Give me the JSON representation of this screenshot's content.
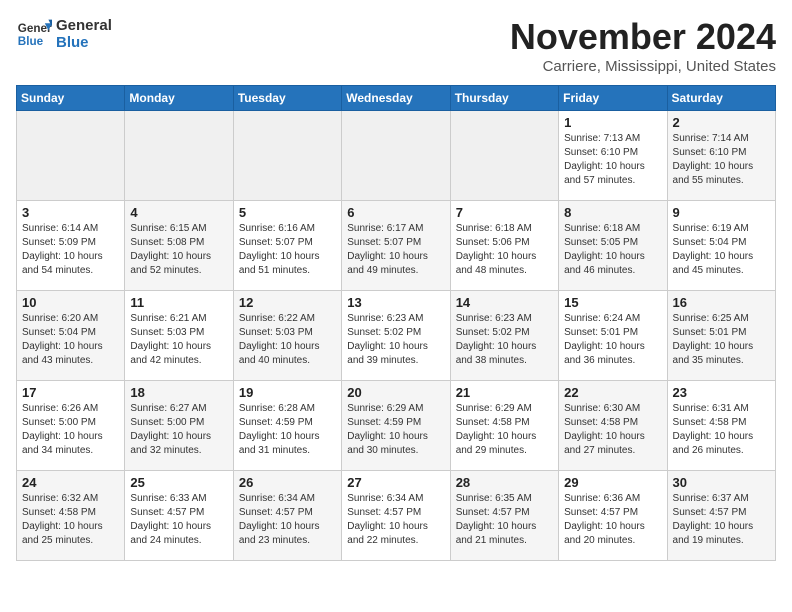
{
  "header": {
    "logo_line1": "General",
    "logo_line2": "Blue",
    "month": "November 2024",
    "location": "Carriere, Mississippi, United States"
  },
  "weekdays": [
    "Sunday",
    "Monday",
    "Tuesday",
    "Wednesday",
    "Thursday",
    "Friday",
    "Saturday"
  ],
  "weeks": [
    [
      {
        "day": "",
        "info": ""
      },
      {
        "day": "",
        "info": ""
      },
      {
        "day": "",
        "info": ""
      },
      {
        "day": "",
        "info": ""
      },
      {
        "day": "",
        "info": ""
      },
      {
        "day": "1",
        "info": "Sunrise: 7:13 AM\nSunset: 6:10 PM\nDaylight: 10 hours and 57 minutes."
      },
      {
        "day": "2",
        "info": "Sunrise: 7:14 AM\nSunset: 6:10 PM\nDaylight: 10 hours and 55 minutes."
      }
    ],
    [
      {
        "day": "3",
        "info": "Sunrise: 6:14 AM\nSunset: 5:09 PM\nDaylight: 10 hours and 54 minutes."
      },
      {
        "day": "4",
        "info": "Sunrise: 6:15 AM\nSunset: 5:08 PM\nDaylight: 10 hours and 52 minutes."
      },
      {
        "day": "5",
        "info": "Sunrise: 6:16 AM\nSunset: 5:07 PM\nDaylight: 10 hours and 51 minutes."
      },
      {
        "day": "6",
        "info": "Sunrise: 6:17 AM\nSunset: 5:07 PM\nDaylight: 10 hours and 49 minutes."
      },
      {
        "day": "7",
        "info": "Sunrise: 6:18 AM\nSunset: 5:06 PM\nDaylight: 10 hours and 48 minutes."
      },
      {
        "day": "8",
        "info": "Sunrise: 6:18 AM\nSunset: 5:05 PM\nDaylight: 10 hours and 46 minutes."
      },
      {
        "day": "9",
        "info": "Sunrise: 6:19 AM\nSunset: 5:04 PM\nDaylight: 10 hours and 45 minutes."
      }
    ],
    [
      {
        "day": "10",
        "info": "Sunrise: 6:20 AM\nSunset: 5:04 PM\nDaylight: 10 hours and 43 minutes."
      },
      {
        "day": "11",
        "info": "Sunrise: 6:21 AM\nSunset: 5:03 PM\nDaylight: 10 hours and 42 minutes."
      },
      {
        "day": "12",
        "info": "Sunrise: 6:22 AM\nSunset: 5:03 PM\nDaylight: 10 hours and 40 minutes."
      },
      {
        "day": "13",
        "info": "Sunrise: 6:23 AM\nSunset: 5:02 PM\nDaylight: 10 hours and 39 minutes."
      },
      {
        "day": "14",
        "info": "Sunrise: 6:23 AM\nSunset: 5:02 PM\nDaylight: 10 hours and 38 minutes."
      },
      {
        "day": "15",
        "info": "Sunrise: 6:24 AM\nSunset: 5:01 PM\nDaylight: 10 hours and 36 minutes."
      },
      {
        "day": "16",
        "info": "Sunrise: 6:25 AM\nSunset: 5:01 PM\nDaylight: 10 hours and 35 minutes."
      }
    ],
    [
      {
        "day": "17",
        "info": "Sunrise: 6:26 AM\nSunset: 5:00 PM\nDaylight: 10 hours and 34 minutes."
      },
      {
        "day": "18",
        "info": "Sunrise: 6:27 AM\nSunset: 5:00 PM\nDaylight: 10 hours and 32 minutes."
      },
      {
        "day": "19",
        "info": "Sunrise: 6:28 AM\nSunset: 4:59 PM\nDaylight: 10 hours and 31 minutes."
      },
      {
        "day": "20",
        "info": "Sunrise: 6:29 AM\nSunset: 4:59 PM\nDaylight: 10 hours and 30 minutes."
      },
      {
        "day": "21",
        "info": "Sunrise: 6:29 AM\nSunset: 4:58 PM\nDaylight: 10 hours and 29 minutes."
      },
      {
        "day": "22",
        "info": "Sunrise: 6:30 AM\nSunset: 4:58 PM\nDaylight: 10 hours and 27 minutes."
      },
      {
        "day": "23",
        "info": "Sunrise: 6:31 AM\nSunset: 4:58 PM\nDaylight: 10 hours and 26 minutes."
      }
    ],
    [
      {
        "day": "24",
        "info": "Sunrise: 6:32 AM\nSunset: 4:58 PM\nDaylight: 10 hours and 25 minutes."
      },
      {
        "day": "25",
        "info": "Sunrise: 6:33 AM\nSunset: 4:57 PM\nDaylight: 10 hours and 24 minutes."
      },
      {
        "day": "26",
        "info": "Sunrise: 6:34 AM\nSunset: 4:57 PM\nDaylight: 10 hours and 23 minutes."
      },
      {
        "day": "27",
        "info": "Sunrise: 6:34 AM\nSunset: 4:57 PM\nDaylight: 10 hours and 22 minutes."
      },
      {
        "day": "28",
        "info": "Sunrise: 6:35 AM\nSunset: 4:57 PM\nDaylight: 10 hours and 21 minutes."
      },
      {
        "day": "29",
        "info": "Sunrise: 6:36 AM\nSunset: 4:57 PM\nDaylight: 10 hours and 20 minutes."
      },
      {
        "day": "30",
        "info": "Sunrise: 6:37 AM\nSunset: 4:57 PM\nDaylight: 10 hours and 19 minutes."
      }
    ]
  ]
}
